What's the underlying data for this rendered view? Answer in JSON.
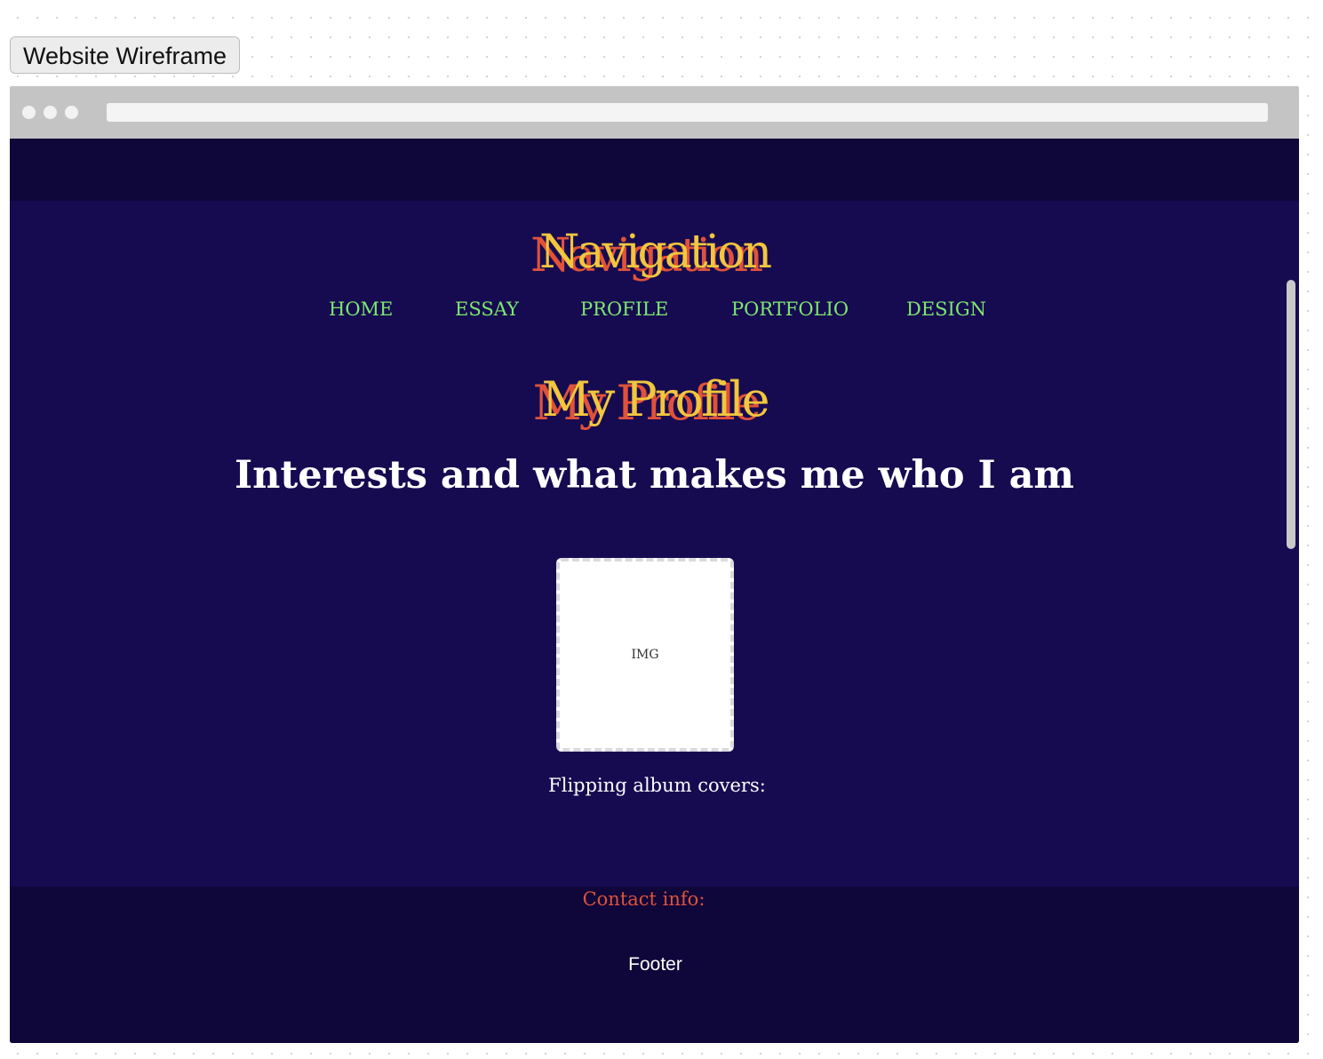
{
  "tag": {
    "label": "Website Wireframe"
  },
  "nav": {
    "heading": "Navigation",
    "items": [
      {
        "label": "HOME"
      },
      {
        "label": "ESSAY"
      },
      {
        "label": "PROFILE"
      },
      {
        "label": "PORTFOLIO"
      },
      {
        "label": "DESIGN"
      }
    ]
  },
  "main": {
    "title": "My Profile",
    "subtitle": "Interests and what makes me who I am",
    "image_placeholder": "IMG",
    "album_label": "Flipping album covers:"
  },
  "footer": {
    "contact_label": "Contact info:",
    "text": "Footer"
  },
  "colors": {
    "page_background": "#160b51",
    "band_background": "#0f063a",
    "heading_front": "#f2c63d",
    "heading_shadow": "#e0523a",
    "nav_link": "#7ee86e",
    "contact_label": "#e0523a"
  }
}
